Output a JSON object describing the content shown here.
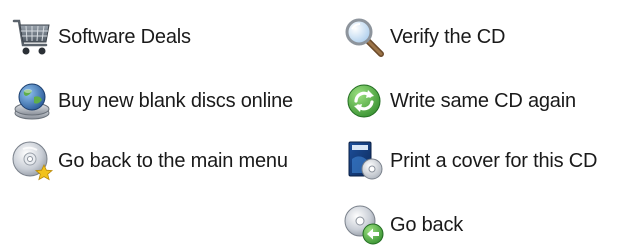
{
  "actions": {
    "software_deals": {
      "label": "Software Deals",
      "icon": "shopping-cart-icon"
    },
    "buy_discs": {
      "label": "Buy new blank discs online",
      "icon": "disc-globe-icon"
    },
    "main_menu": {
      "label": "Go back to the main menu",
      "icon": "disc-star-icon"
    },
    "verify": {
      "label": "Verify the CD",
      "icon": "magnifier-icon"
    },
    "write_again": {
      "label": "Write same CD again",
      "icon": "green-refresh-icon"
    },
    "print_cover": {
      "label": "Print a cover for this CD",
      "icon": "dvd-case-icon"
    },
    "go_back": {
      "label": "Go back",
      "icon": "disc-back-arrow-icon"
    }
  },
  "colors": {
    "text": "#1a1a1a",
    "background": "#ffffff",
    "green": "#3fa33a",
    "disc_silver": "#c8ccd2",
    "star_gold": "#f2c21a",
    "globe_blue": "#2f6db5"
  }
}
